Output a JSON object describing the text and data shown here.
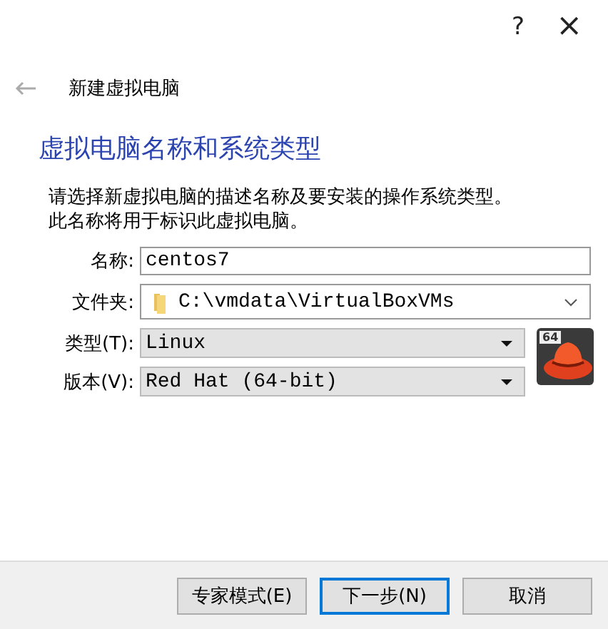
{
  "window": {
    "help": "?",
    "close": "×"
  },
  "header": {
    "title": "新建虚拟电脑"
  },
  "heading": "虚拟电脑名称和系统类型",
  "description": [
    "请选择新虚拟电脑的描述名称及要安装的操作系统类型。",
    "此名称将用于标识此虚拟电脑。"
  ],
  "fields": [
    {
      "kind": "text",
      "label": "名称:",
      "value": "centos7"
    },
    {
      "kind": "folder",
      "label": "文件夹:",
      "value": "C:\\vmdata\\VirtualBoxVMs"
    },
    {
      "kind": "select",
      "label": "类型(T):",
      "value": "Linux"
    },
    {
      "kind": "select",
      "label": "版本(V):",
      "value": "Red Hat (64-bit)"
    }
  ],
  "os_icon": {
    "badge": "64"
  },
  "buttons": [
    {
      "label": "专家模式(E)",
      "selected": false
    },
    {
      "label": "下一步(N)",
      "selected": true
    },
    {
      "label": "取消",
      "selected": false
    }
  ]
}
